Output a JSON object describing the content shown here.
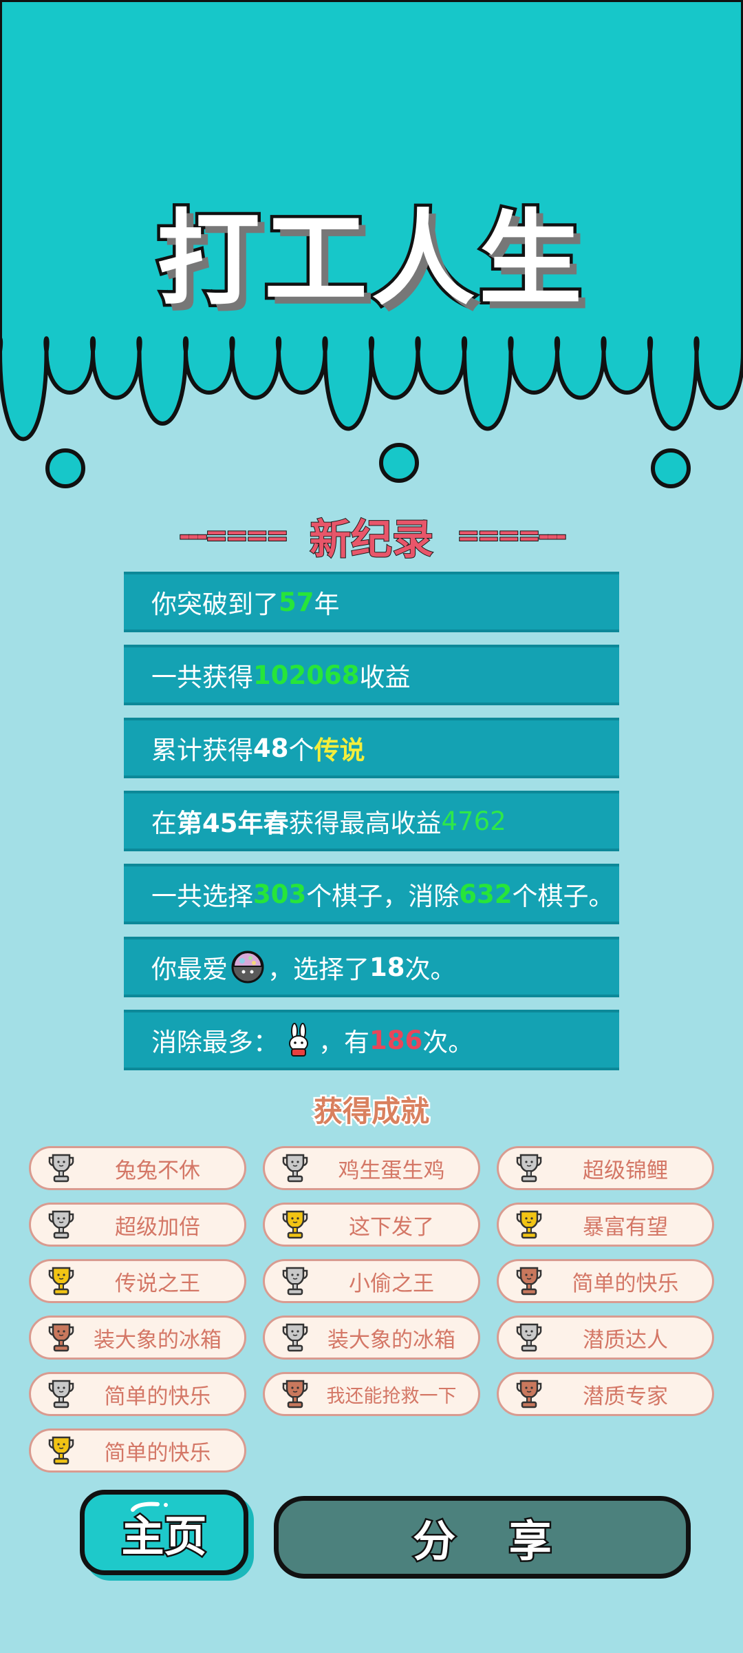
{
  "game_title": "打工人生",
  "record": {
    "title": "新纪录",
    "left_decor": "---====",
    "right_decor": "====---"
  },
  "stats": {
    "years": {
      "before": "你突破到了",
      "value": "57",
      "after": "年"
    },
    "income": {
      "before": "一共获得",
      "value": "102068",
      "after": "收益"
    },
    "legend": {
      "before": "累计获得",
      "value": "48",
      "mid": "个",
      "highlight": "传说"
    },
    "best": {
      "before": "在 ",
      "season": "第45年春",
      "mid": " 获得最高收益",
      "value": "4762"
    },
    "pieces": {
      "before": "一共选择",
      "chosen": "303",
      "mid1": "个棋子，消除",
      "removed": "632",
      "after": "个棋子。"
    },
    "favorite": {
      "before": "你最爱",
      "icon": "robot-ball-sticker",
      "mid": "，选择了",
      "count": "18",
      "after": "次。"
    },
    "most_removed": {
      "before": "消除最多：",
      "icon": "rabbit-sticker",
      "mid": "，有",
      "count": "186",
      "after": "次。"
    }
  },
  "achievements": {
    "title": "获得成就",
    "items": [
      {
        "label": "兔兔不休",
        "tier": "silver"
      },
      {
        "label": "鸡生蛋生鸡",
        "tier": "silver"
      },
      {
        "label": "超级锦鲤",
        "tier": "silver"
      },
      {
        "label": "超级加倍",
        "tier": "silver"
      },
      {
        "label": "这下发了",
        "tier": "gold"
      },
      {
        "label": "暴富有望",
        "tier": "gold"
      },
      {
        "label": "传说之王",
        "tier": "gold"
      },
      {
        "label": "小偷之王",
        "tier": "silver"
      },
      {
        "label": "简单的快乐",
        "tier": "bronze"
      },
      {
        "label": "装大象的冰箱",
        "tier": "bronze"
      },
      {
        "label": "装大象的冰箱",
        "tier": "silver"
      },
      {
        "label": "潜质达人",
        "tier": "silver"
      },
      {
        "label": "简单的快乐",
        "tier": "silver"
      },
      {
        "label": "我还能抢救一下",
        "tier": "bronze"
      },
      {
        "label": "潜质专家",
        "tier": "bronze"
      },
      {
        "label": "简单的快乐",
        "tier": "gold"
      }
    ]
  },
  "buttons": {
    "home": "主页",
    "share": "分 享"
  },
  "colors": {
    "top_teal": "#17c7c9",
    "page_bg": "#a3dfe6",
    "row_bg": "#14a2b3",
    "accent_pink": "#e8566a",
    "highlight_green": "#27e53a",
    "highlight_yellow": "#f3ee3c",
    "highlight_red": "#e8465a",
    "trophy_gold": "#f2c414",
    "trophy_silver": "#c9c9c9",
    "trophy_bronze": "#c9785d"
  }
}
